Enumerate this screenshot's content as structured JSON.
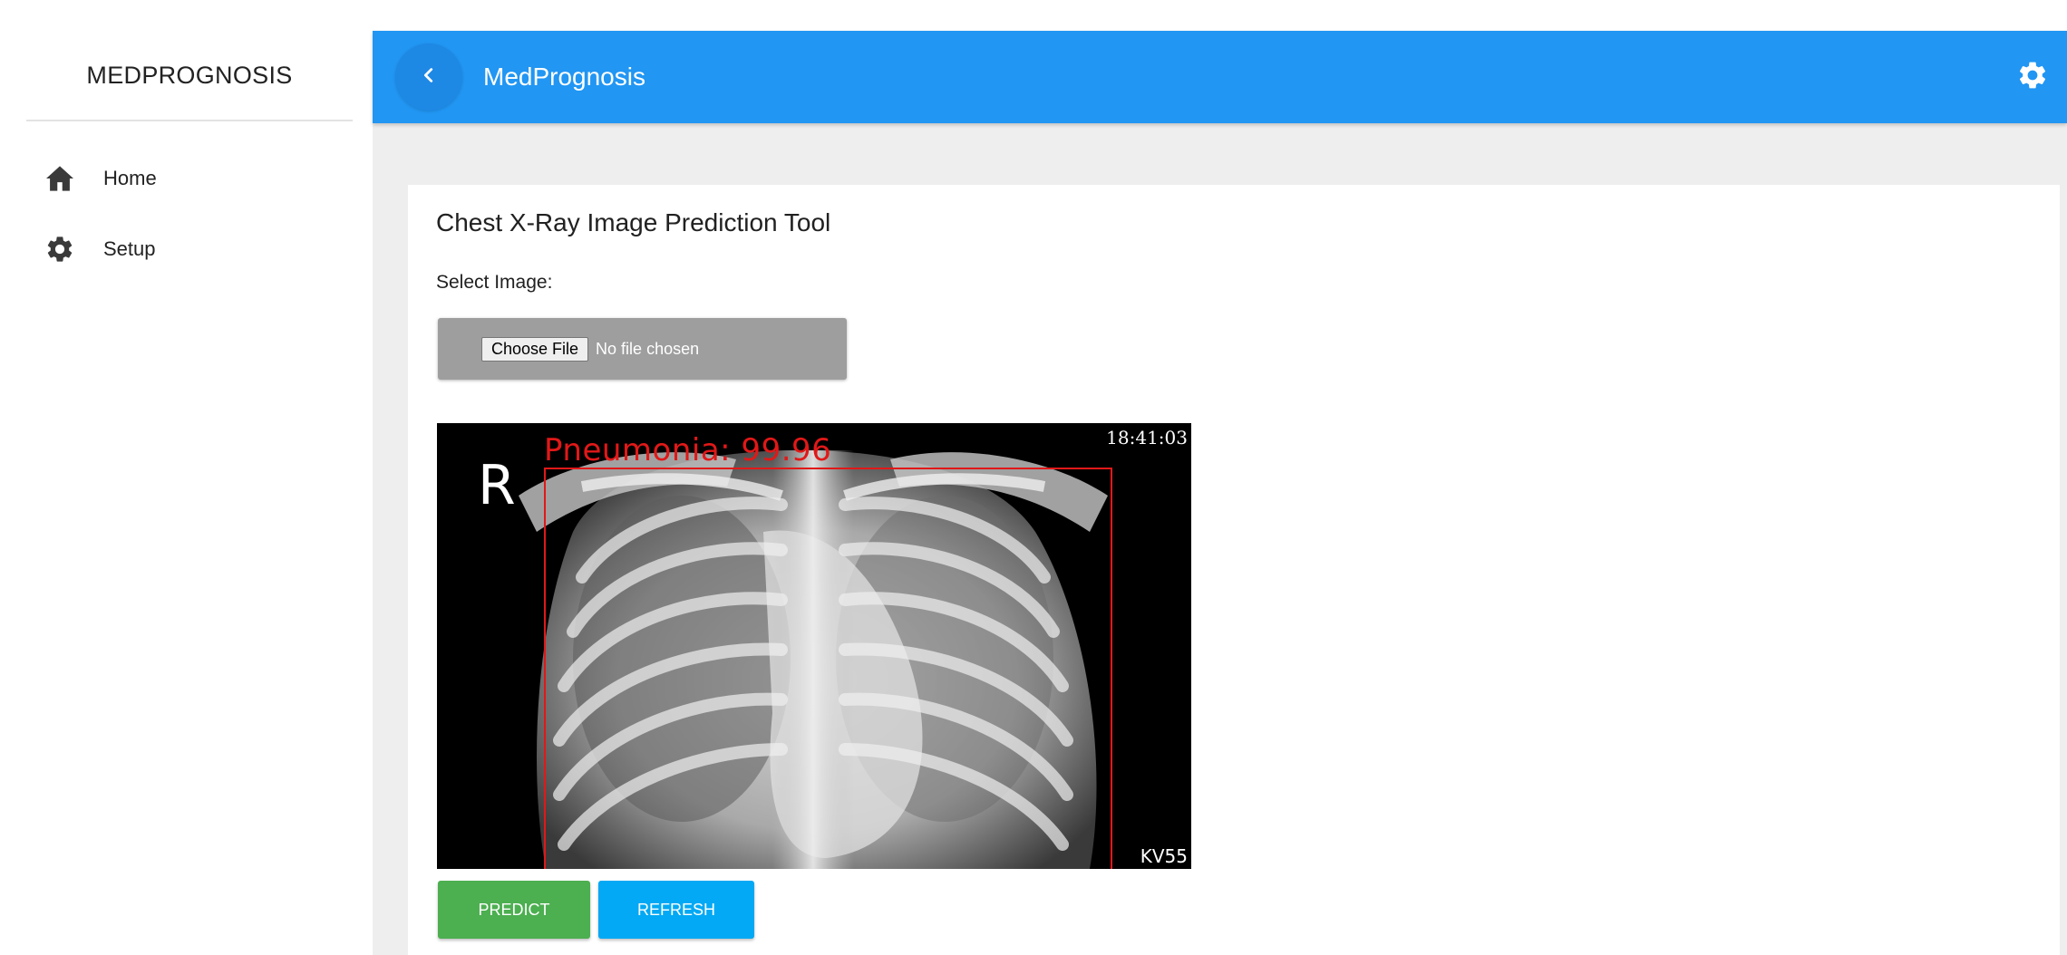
{
  "sidebar": {
    "brand": "MEDPROGNOSIS",
    "items": [
      {
        "label": "Home",
        "icon": "home-icon"
      },
      {
        "label": "Setup",
        "icon": "gear-icon"
      }
    ]
  },
  "appbar": {
    "title": "MedPrognosis",
    "back_icon": "chevron-left-icon",
    "settings_icon": "gear-icon",
    "color": "#2196f3"
  },
  "card": {
    "title": "Chest X-Ray Image Prediction Tool",
    "select_label": "Select Image:",
    "file_button": "Choose File",
    "file_status": "No file chosen"
  },
  "xray": {
    "timestamp": "18:41:03",
    "side_marker": "R",
    "corner_label": "KV55",
    "prediction": "Pneumonia: 99.96",
    "box_color": "#e11818"
  },
  "actions": {
    "predict": "PREDICT",
    "refresh": "REFRESH",
    "predict_color": "#4caf50",
    "refresh_color": "#03a9f4"
  }
}
